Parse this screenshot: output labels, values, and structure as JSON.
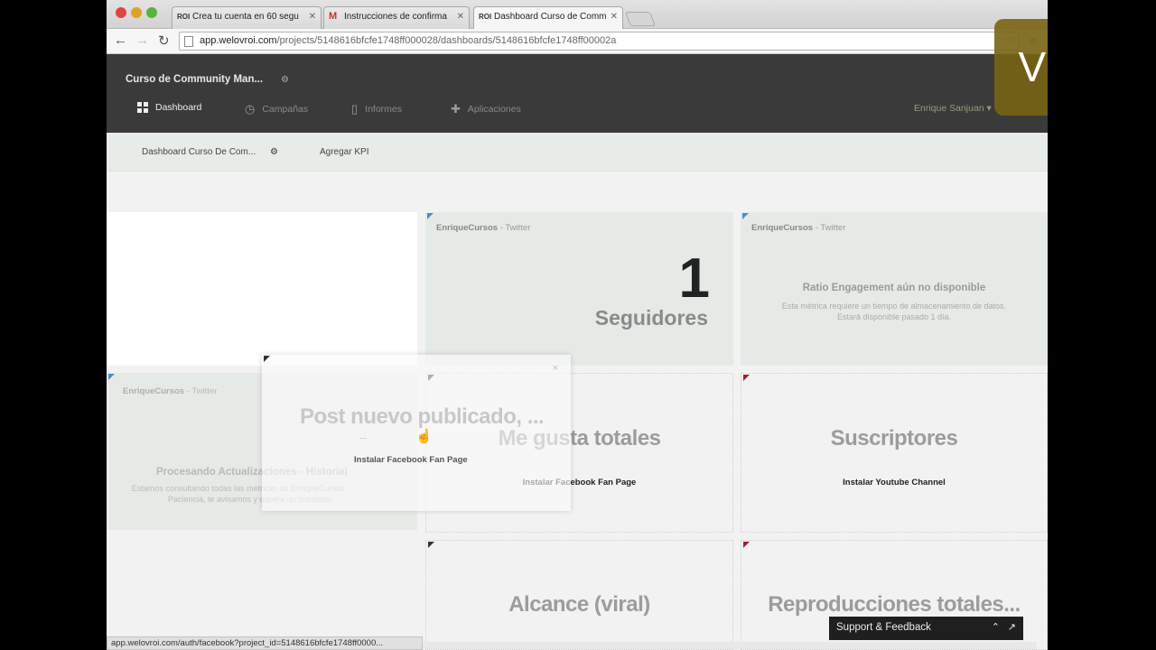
{
  "browser": {
    "tabs": [
      {
        "favicon": "ROI",
        "title": "Crea tu cuenta en 60 segu"
      },
      {
        "favicon": "M",
        "title": "Instrucciones de confirma"
      },
      {
        "favicon": "ROI",
        "title": "Dashboard Curso de Comm"
      }
    ],
    "url_host": "app.welovroi.com",
    "url_path": "/projects/5148616bfcfe1748ff000028/dashboards/5148616bfcfe1748ff00002a",
    "status_url": "app.welovroi.com/auth/facebook?project_id=5148616bfcfe1748ff0000..."
  },
  "app": {
    "project_title": "Curso de Community Man...",
    "nav": [
      {
        "label": "Dashboard",
        "icon": "grid-icon",
        "active": true
      },
      {
        "label": "Campañas",
        "icon": "clock-icon",
        "active": false
      },
      {
        "label": "Informes",
        "icon": "document-icon",
        "active": false
      },
      {
        "label": "Aplicaciones",
        "icon": "plus-icon",
        "active": false
      }
    ],
    "user_link": "Enrique Sanjuan ▾"
  },
  "subnav": {
    "dashboard_name": "Dashboard Curso De Com...",
    "add_kpi": "Agregar KPI"
  },
  "widgets": {
    "followers": {
      "account": "EnriqueCursos",
      "network": " - Twitter",
      "value": "1",
      "label": "Seguidores"
    },
    "engagement": {
      "account": "EnriqueCursos",
      "network": " - Twitter",
      "heading": "Ratio Engagement aún no disponible",
      "text1": "Esta métrica requiere un tiempo de almacenamiento de datos.",
      "text2": "Estará disponible pasado 1 día."
    },
    "processing": {
      "account": "EnriqueCursos",
      "network": " - Twitter",
      "heading": "Procesando Actualizaciones - Historial",
      "text1": "Estamos consultando todas las métricas de EnriqueCursos.",
      "text2": "Paciencia, te avisamos y espera un momento."
    },
    "likes": {
      "title": "Me gusta totales",
      "link": "Instalar Facebook Fan Page"
    },
    "subscribers": {
      "title": "Suscriptores",
      "link": "Instalar Youtube Channel"
    },
    "reach": {
      "title": "Alcance (viral)"
    },
    "plays": {
      "title": "Reproducciones totales..."
    }
  },
  "modal": {
    "heading": "Post nuevo publicado, ...",
    "loader": "...",
    "link": "Instalar Facebook Fan Page",
    "close": "×"
  },
  "support": {
    "label": "Support & Feedback"
  },
  "watermark": {
    "text": "Visor"
  }
}
